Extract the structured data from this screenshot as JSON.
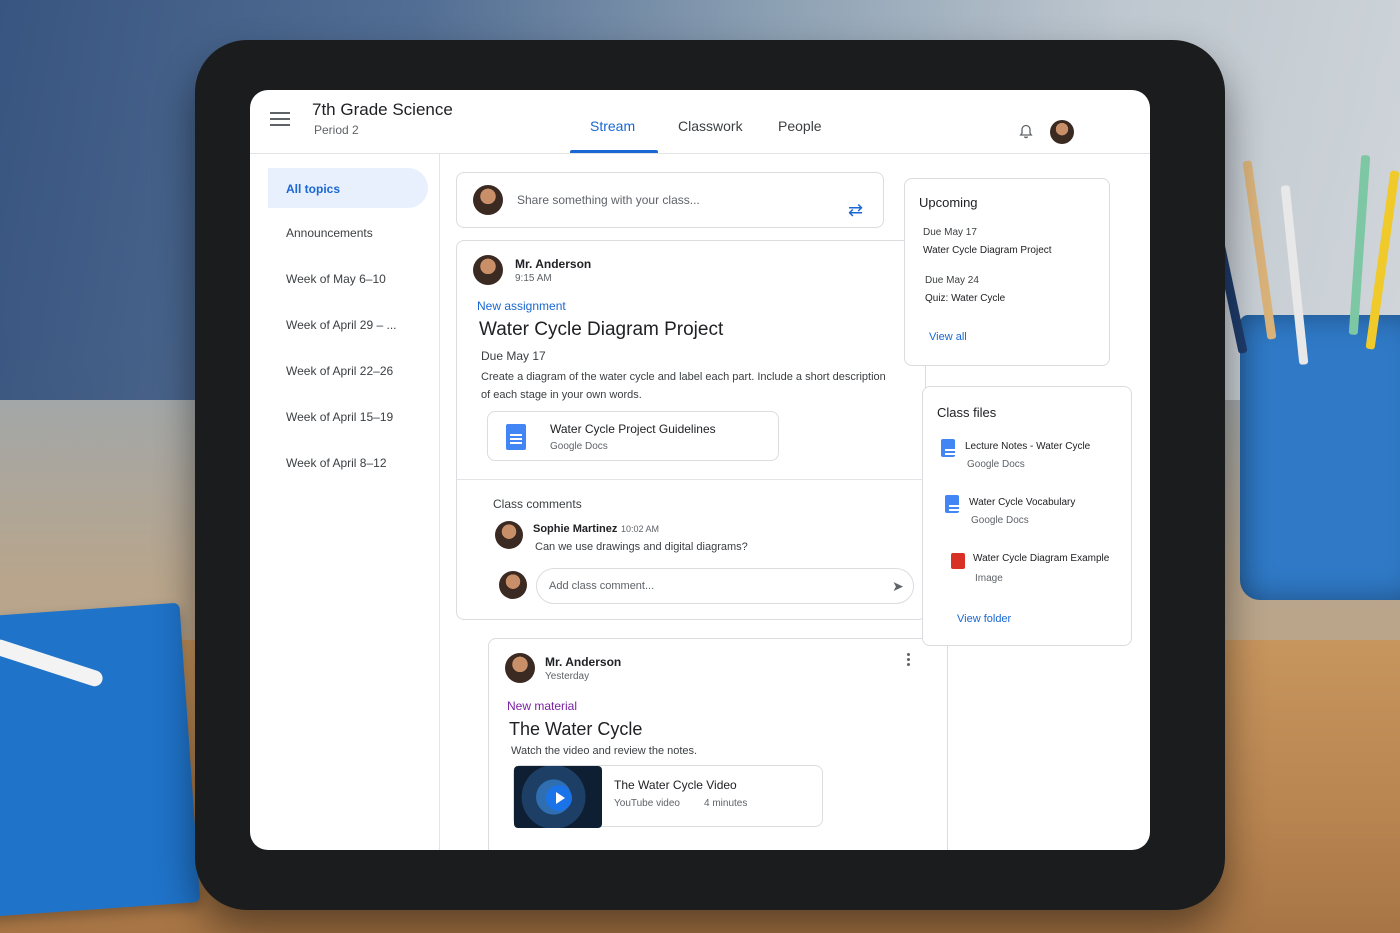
{
  "header": {
    "class_title": "7th Grade Science",
    "class_period": "Period 2",
    "tabs": [
      "Stream",
      "Classwork",
      "People"
    ],
    "active_tab": "Stream"
  },
  "sidebar": {
    "items": [
      "All topics",
      "Announcements",
      "Week of May 6–10",
      "Week of April 29 – ...",
      "Week of April 22–26",
      "Week of April 15–19",
      "Week of April 8–12"
    ]
  },
  "composer": {
    "placeholder": "Share something with your class..."
  },
  "post1": {
    "author": "Mr. Anderson",
    "time": "9:15 AM",
    "kind": "New assignment",
    "title": "Water Cycle Diagram Project",
    "due": "Due May 17",
    "description_line1": "Create a diagram of the water cycle and label each part. Include a short description",
    "description_line2": "of each stage in your own words.",
    "attachment_title": "Water Cycle Project Guidelines",
    "attachment_type": "Google Docs",
    "comments_heading": "Class comments",
    "comment_author": "Sophie Martinez",
    "comment_time": "10:02 AM",
    "comment_text": "Can we use drawings and digital diagrams?",
    "comment_placeholder": "Add class comment..."
  },
  "post2": {
    "author": "Mr. Anderson",
    "time": "Yesterday",
    "kind": "New material",
    "title": "The Water Cycle",
    "description": "Watch the video and review the notes.",
    "video_title": "The Water Cycle Video",
    "video_source": "YouTube video",
    "video_length": "4 minutes"
  },
  "upcoming": {
    "heading": "Upcoming",
    "items": [
      {
        "due": "Due May 17",
        "title": "Water Cycle Diagram Project"
      },
      {
        "due": "Due May 24",
        "title": "Quiz: Water Cycle"
      }
    ],
    "view_all": "View all"
  },
  "class_files": {
    "heading": "Class files",
    "files": [
      {
        "title": "Lecture Notes - Water Cycle",
        "type": "Google Docs"
      },
      {
        "title": "Water Cycle Vocabulary",
        "type": "Google Docs"
      },
      {
        "title": "Water Cycle Diagram Example",
        "type": "Image"
      }
    ],
    "view_folder": "View folder"
  },
  "colors": {
    "accent": "#1967d2",
    "material_accent": "#7b1fa2",
    "doc_blue": "#4285f4",
    "image_red": "#d93025"
  }
}
